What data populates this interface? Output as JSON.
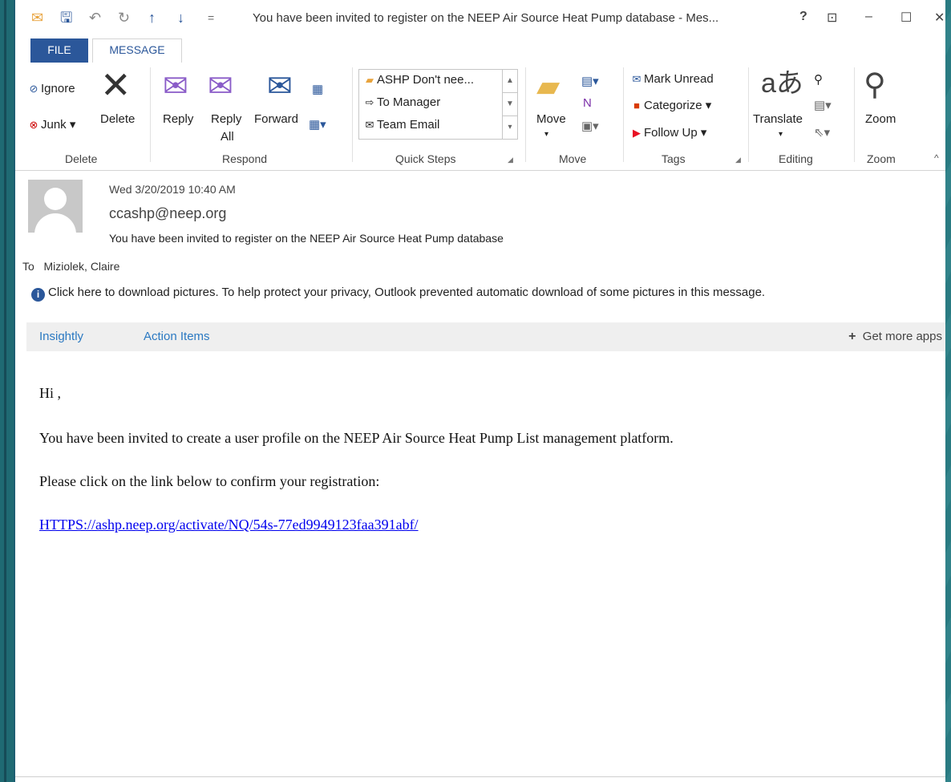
{
  "window": {
    "title": "You have been invited to register on the NEEP Air Source Heat Pump database - Mes...",
    "controls": {
      "help": "?",
      "restore_ribbon": "⊡",
      "minimize": "–",
      "maximize": "☐",
      "close": "✕"
    }
  },
  "quick_access": {
    "mail_icon": "envelope-icon",
    "save_icon": "save-icon",
    "undo_icon": "undo-icon",
    "redo_icon": "redo-icon",
    "up_icon": "arrow-up-icon",
    "down_icon": "arrow-down-icon",
    "customize": "="
  },
  "tabs": {
    "file": "FILE",
    "message": "MESSAGE"
  },
  "ribbon": {
    "delete_group": {
      "ignore": "Ignore",
      "junk": "Junk",
      "delete": "Delete",
      "label": "Delete"
    },
    "respond_group": {
      "reply": "Reply",
      "reply_all_1": "Reply",
      "reply_all_2": "All",
      "forward": "Forward",
      "label": "Respond"
    },
    "quick_steps": {
      "items": [
        "ASHP Don't nee...",
        "To Manager",
        "Team Email"
      ],
      "label": "Quick Steps"
    },
    "move_group": {
      "move": "Move",
      "label": "Move"
    },
    "tags_group": {
      "mark_unread": "Mark Unread",
      "categorize": "Categorize",
      "follow_up": "Follow Up",
      "label": "Tags"
    },
    "editing_group": {
      "translate": "Translate",
      "label": "Editing"
    },
    "zoom_group": {
      "zoom": "Zoom",
      "label": "Zoom"
    }
  },
  "message": {
    "date": "Wed 3/20/2019 10:40 AM",
    "from": "ccashp@neep.org",
    "subject": "You have been invited to register on the NEEP Air Source Heat Pump database",
    "to_label": "To",
    "to": "Miziolek, Claire",
    "info_text": "Click here to download pictures. To help protect your privacy, Outlook prevented automatic download of some pictures in this message."
  },
  "apps": {
    "insightly": "Insightly",
    "action_items": "Action Items",
    "get_more": "Get more apps"
  },
  "body": {
    "greeting": "Hi ,",
    "para1": "You have been invited to create a user profile on the NEEP Air Source Heat Pump List management platform.",
    "para2": "Please click on the link below to confirm your registration:",
    "link": "HTTPS://ashp.neep.org/activate/NQ/54s-77ed9949123faa391abf/"
  },
  "colors": {
    "accent": "#2b579a",
    "link": "#0000ee",
    "desktop": "#2a7f86"
  }
}
